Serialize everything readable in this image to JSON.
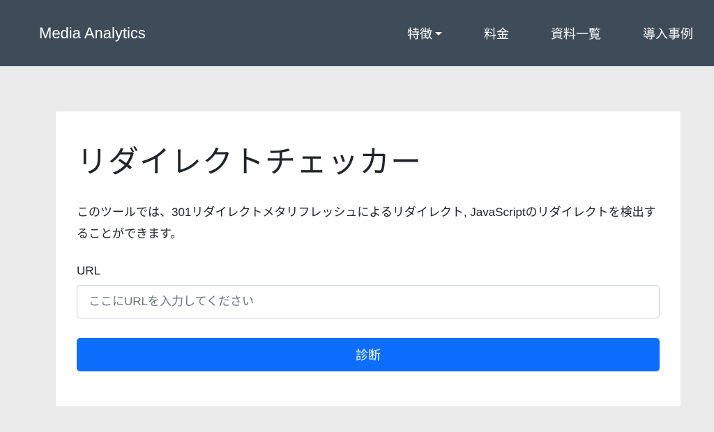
{
  "navbar": {
    "brand": "Media Analytics",
    "links": [
      {
        "label": "特徴",
        "has_dropdown": true
      },
      {
        "label": "料金",
        "has_dropdown": false
      },
      {
        "label": "資料一覧",
        "has_dropdown": false
      },
      {
        "label": "導入事例",
        "has_dropdown": false
      }
    ]
  },
  "main": {
    "title": "リダイレクトチェッカー",
    "description": "このツールでは、301リダイレクトメタリフレッシュによるリダイレクト, JavaScriptのリダイレクトを検出することができます。",
    "form": {
      "label": "URL",
      "placeholder": "ここにURLを入力してください",
      "value": "",
      "submit_label": "診断"
    }
  }
}
